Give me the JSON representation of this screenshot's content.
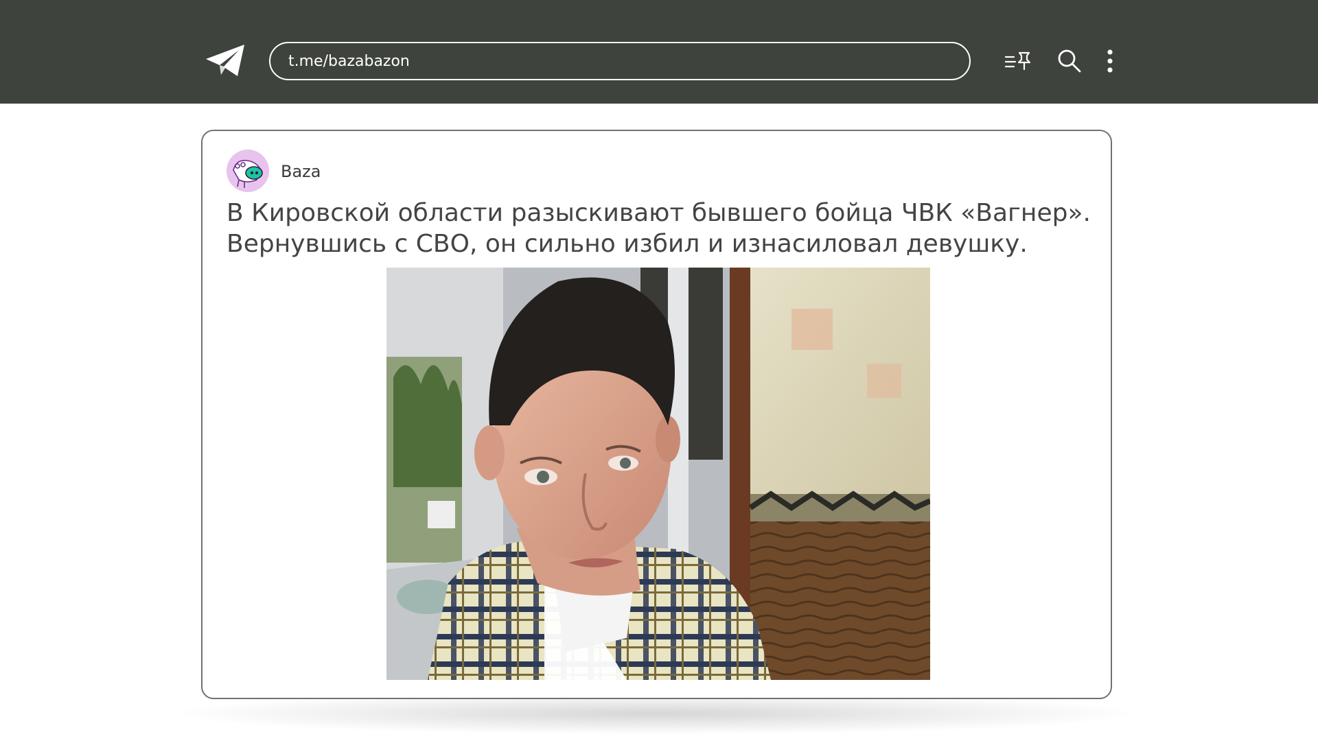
{
  "header": {
    "url": "t.me/bazabazon",
    "icons": [
      "telegram-logo-icon",
      "pinned-list-icon",
      "search-icon",
      "more-vertical-icon"
    ],
    "background_color": "#3f433d"
  },
  "post": {
    "channel_name": "Baza",
    "text_line1": "В Кировской области разыскивают бывшего бойца ЧВК «Вагнер».",
    "text_line2": "Вернувшись с СВО, он сильно избил и изнасиловал девушку.",
    "avatar_color": "#e8c3ee",
    "photo_icon": "photo-of-man-selfie"
  }
}
